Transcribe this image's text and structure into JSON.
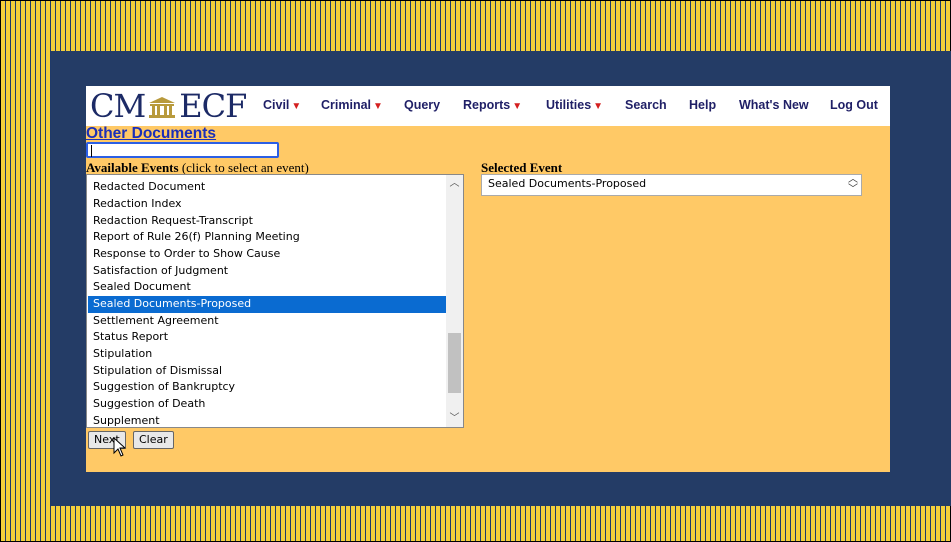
{
  "logo": {
    "left": "CM",
    "right": "ECF"
  },
  "menu": [
    {
      "label": "Civil",
      "has_dropdown": true
    },
    {
      "label": "Criminal",
      "has_dropdown": true
    },
    {
      "label": "Query",
      "has_dropdown": false
    },
    {
      "label": "Reports",
      "has_dropdown": true
    },
    {
      "label": "Utilities",
      "has_dropdown": true
    },
    {
      "label": "Search",
      "has_dropdown": false
    },
    {
      "label": "Help",
      "has_dropdown": false
    },
    {
      "label": "What's New",
      "has_dropdown": false
    },
    {
      "label": "Log Out",
      "has_dropdown": false
    }
  ],
  "page_title": "Other Documents",
  "search": {
    "value": ""
  },
  "available": {
    "label_bold": "Available Events",
    "label_hint": "(click to select an event)",
    "items": [
      "Redacted Document",
      "Redaction Index",
      "Redaction Request-Transcript",
      "Report of Rule 26(f) Planning Meeting",
      "Response to Order to Show Cause",
      "Satisfaction of Judgment",
      "Sealed Document",
      "Sealed Documents-Proposed",
      "Settlement Agreement",
      "Status Report",
      "Stipulation",
      "Stipulation of Dismissal",
      "Suggestion of Bankruptcy",
      "Suggestion of Death",
      "Supplement"
    ],
    "selected_index": 7
  },
  "selected": {
    "label": "Selected Event",
    "value": "Sealed Documents-Proposed"
  },
  "buttons": {
    "next": "Next",
    "clear": "Clear"
  },
  "colors": {
    "panel": "#ffc966",
    "frame": "#243c66",
    "selection": "#0a6bd1",
    "stripe": "#f5cf3a"
  },
  "icons": [
    "courthouse-icon",
    "dropdown-caret-icon",
    "scroll-up-icon",
    "scroll-down-icon",
    "mouse-pointer-icon"
  ]
}
